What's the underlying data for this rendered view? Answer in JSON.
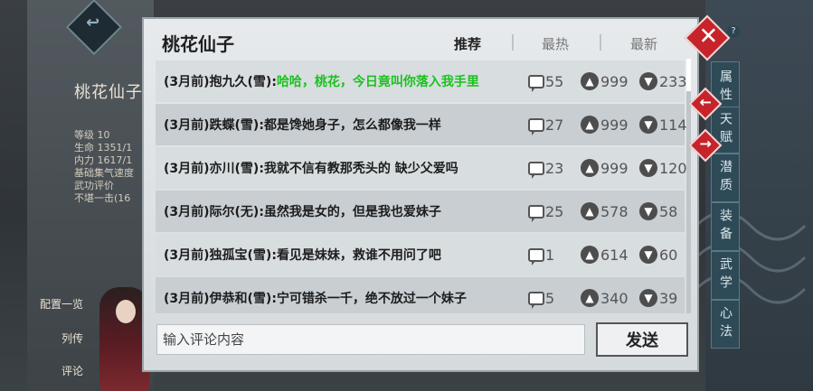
{
  "background": {
    "character_name": "桃花仙子",
    "stats": [
      "等级 10",
      "生命 1351/1",
      "内力 1617/1",
      "基础集气速度",
      "武功评价",
      "不堪一击(16"
    ],
    "left_buttons": [
      "配置一览",
      "列传",
      "评论"
    ],
    "side_tabs": [
      "属性",
      "天赋",
      "潜质",
      "装备",
      "武学",
      "心法"
    ]
  },
  "dialog": {
    "title": "桃花仙子",
    "tabs": [
      {
        "label": "推荐",
        "active": true
      },
      {
        "label": "最热",
        "active": false
      },
      {
        "label": "最新",
        "active": false
      }
    ],
    "comments": [
      {
        "prefix": "(3月前)抱九久(雪):",
        "text": "哈哈，桃花，今日竟叫你落入我手里",
        "highlight": true,
        "replies": "55",
        "likes": "999",
        "dislikes": "233"
      },
      {
        "prefix": "(3月前)跌蝶(雪):",
        "text": "都是馋她身子，怎么都像我一样",
        "highlight": false,
        "replies": "27",
        "likes": "999",
        "dislikes": "114"
      },
      {
        "prefix": "(3月前)亦川(雪):",
        "text": "我就不信有教那秃头的 缺少父爱吗",
        "highlight": false,
        "replies": "23",
        "likes": "999",
        "dislikes": "120"
      },
      {
        "prefix": "(3月前)际尔(无):",
        "text": "虽然我是女的，但是我也爱妹子",
        "highlight": false,
        "replies": "25",
        "likes": "578",
        "dislikes": "58"
      },
      {
        "prefix": "(3月前)独孤宝(雪):",
        "text": "看见是妹妹，救谁不用问了吧",
        "highlight": false,
        "replies": "1",
        "likes": "614",
        "dislikes": "60"
      },
      {
        "prefix": "(3月前)伊恭和(雪):",
        "text": "宁可错杀一千，绝不放过一个妹子",
        "highlight": false,
        "replies": "5",
        "likes": "340",
        "dislikes": "39"
      }
    ],
    "input_placeholder": "输入评论内容",
    "send_label": "发送"
  },
  "icons": {
    "close": "close-icon",
    "reply": "speech-bubble-icon",
    "like": "thumbs-up-icon",
    "dislike": "thumbs-down-icon",
    "help": "help-icon"
  },
  "colors": {
    "highlight_text": "#19c21c",
    "close_button": "#c6242a"
  }
}
